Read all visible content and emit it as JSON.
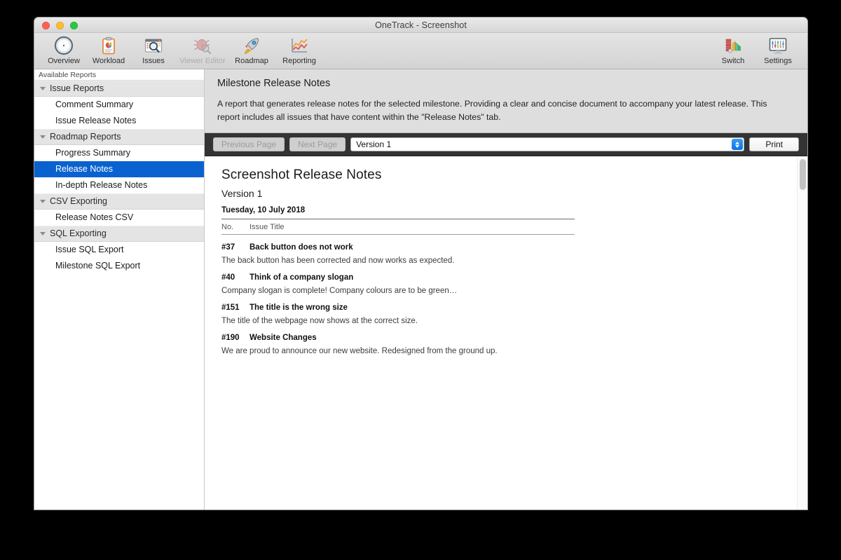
{
  "window": {
    "title": "OneTrack - Screenshot",
    "traffic_lights": [
      "close",
      "minimize",
      "zoom"
    ]
  },
  "toolbar": {
    "left_items": [
      {
        "label": "Overview",
        "icon": "compass-icon",
        "enabled": true
      },
      {
        "label": "Workload",
        "icon": "clipboard-chart-icon",
        "enabled": true
      },
      {
        "label": "Issues",
        "icon": "magnifier-grid-icon",
        "enabled": true
      },
      {
        "label": "Viewer Editor",
        "icon": "bug-magnifier-icon",
        "enabled": false
      },
      {
        "label": "Roadmap",
        "icon": "rocket-icon",
        "enabled": true
      },
      {
        "label": "Reporting",
        "icon": "line-chart-icon",
        "enabled": true
      }
    ],
    "right_items": [
      {
        "label": "Switch",
        "icon": "color-swatches-icon",
        "enabled": true
      },
      {
        "label": "Settings",
        "icon": "monitor-sliders-icon",
        "enabled": true
      }
    ]
  },
  "sidebar": {
    "caption": "Available Reports",
    "groups": [
      {
        "label": "Issue Reports",
        "items": [
          {
            "label": "Comment Summary",
            "selected": false
          },
          {
            "label": "Issue Release Notes",
            "selected": false
          }
        ]
      },
      {
        "label": "Roadmap Reports",
        "items": [
          {
            "label": "Progress Summary",
            "selected": false
          },
          {
            "label": "Release Notes",
            "selected": true
          },
          {
            "label": "In-depth Release Notes",
            "selected": false
          }
        ]
      },
      {
        "label": "CSV Exporting",
        "items": [
          {
            "label": "Release Notes CSV",
            "selected": false
          }
        ]
      },
      {
        "label": "SQL Exporting",
        "items": [
          {
            "label": "Issue SQL Export",
            "selected": false
          },
          {
            "label": "Milestone SQL Export",
            "selected": false
          }
        ]
      }
    ]
  },
  "description": {
    "title": "Milestone Release Notes",
    "text": "A report that generates release notes for the selected milestone. Providing a clear and concise document to accompany your latest release. This report includes all issues that have content within the \"Release Notes\" tab."
  },
  "report_bar": {
    "previous_page": "Previous Page",
    "previous_page_enabled": false,
    "next_page": "Next Page",
    "next_page_enabled": false,
    "version_value": "Version 1",
    "version_options": [
      "Version 1"
    ],
    "print": "Print"
  },
  "document": {
    "title": "Screenshot Release Notes",
    "subtitle": "Version 1",
    "date": "Tuesday, 10 July 2018",
    "columns": {
      "no": "No.",
      "title": "Issue Title"
    },
    "entries": [
      {
        "no": "#37",
        "title": "Back button does not work",
        "body": "The back button has been corrected and now works as expected."
      },
      {
        "no": "#40",
        "title": "Think of a company slogan",
        "body": "Company slogan is complete! Company colours are to be green…"
      },
      {
        "no": "#151",
        "title": "The title is the wrong size",
        "body": "The title of the webpage now shows at the correct size."
      },
      {
        "no": "#190",
        "title": "Website Changes",
        "body": "We are proud to announce our new website. Redesigned from the ground up."
      }
    ]
  },
  "colors": {
    "selection_blue": "#0a62d0",
    "report_bar": "#333333",
    "description_bg": "#dedede",
    "window_bg": "#ececec"
  }
}
